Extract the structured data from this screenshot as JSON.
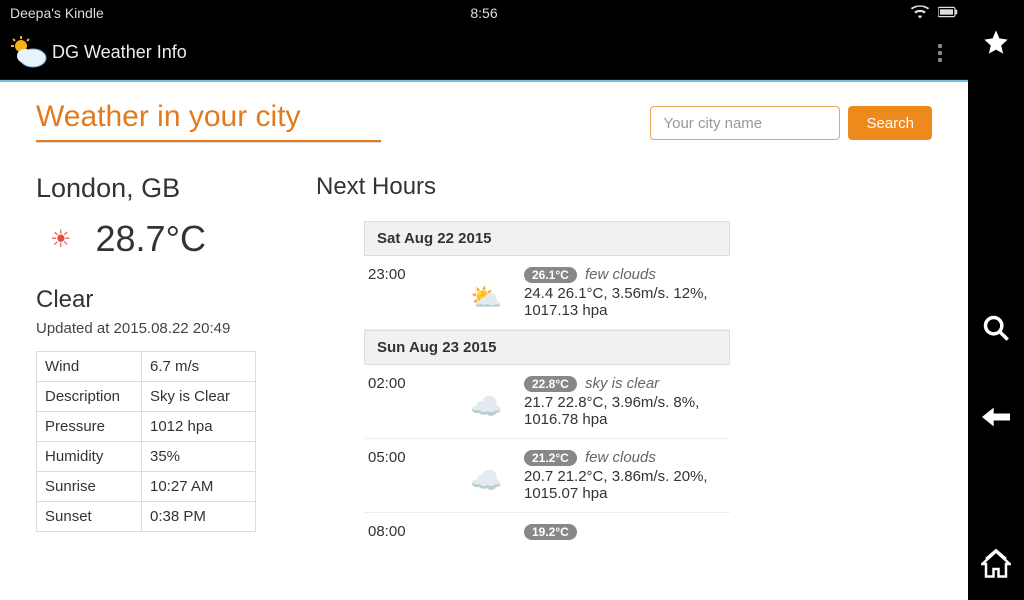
{
  "status": {
    "device": "Deepa's Kindle",
    "clock": "8:56"
  },
  "appbar": {
    "title": "DG Weather Info"
  },
  "page": {
    "heading": "Weather in your city",
    "search_placeholder": "Your city name",
    "search_button": "Search"
  },
  "current": {
    "city": "London, GB",
    "temp": "28.7°C",
    "condition": "Clear",
    "updated": "Updated at 2015.08.22 20:49",
    "details": {
      "wind_label": "Wind",
      "wind": "6.7 m/s",
      "desc_label": "Description",
      "desc": "Sky is Clear",
      "pressure_label": "Pressure",
      "pressure": "1012 hpa",
      "humidity_label": "Humidity",
      "humidity": "35%",
      "sunrise_label": "Sunrise",
      "sunrise": "10:27 AM",
      "sunset_label": "Sunset",
      "sunset": "0:38 PM"
    }
  },
  "forecast": {
    "title": "Next Hours",
    "day1": {
      "header": "Sat Aug 22 2015",
      "h1": {
        "time": "23:00",
        "pill": "26.1°C",
        "cond": "few clouds",
        "line": "24.4 26.1°C, 3.56m/s. 12%, 1017.13 hpa"
      }
    },
    "day2": {
      "header": "Sun Aug 23 2015",
      "h1": {
        "time": "02:00",
        "pill": "22.8°C",
        "cond": "sky is clear",
        "line": "21.7 22.8°C, 3.96m/s. 8%, 1016.78 hpa"
      },
      "h2": {
        "time": "05:00",
        "pill": "21.2°C",
        "cond": "few clouds",
        "line": "20.7 21.2°C, 3.86m/s. 20%, 1015.07 hpa"
      },
      "h3": {
        "time": "08:00",
        "pill": "19.2°C"
      }
    }
  }
}
